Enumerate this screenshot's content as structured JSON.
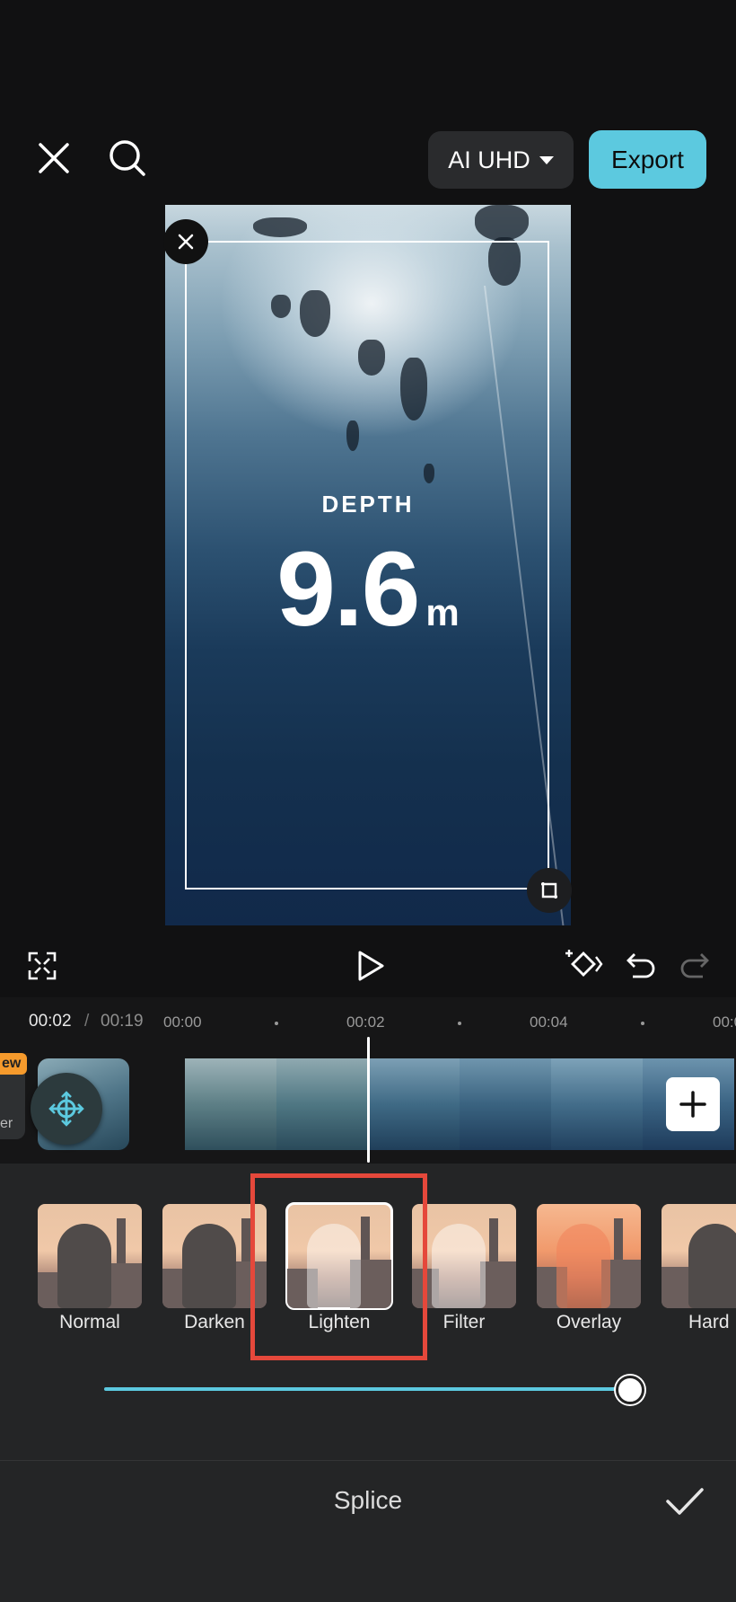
{
  "topbar": {
    "close_icon": "close-icon",
    "search_icon": "search-icon",
    "quality_label": "AI UHD",
    "export_label": "Export"
  },
  "preview": {
    "depth_label": "DEPTH",
    "depth_value": "9.6",
    "depth_unit": "m"
  },
  "playback": {
    "icons": [
      "fullscreen-icon",
      "play-icon",
      "keyframe-icon",
      "undo-icon",
      "redo-icon"
    ]
  },
  "timeline": {
    "current_time": "00:02",
    "separator": "/",
    "total_time": "00:19",
    "ticks": [
      "00:00",
      "00:02",
      "00:04",
      "00:0"
    ],
    "new_badge": "ew",
    "side_clip_label": "er",
    "cover_label": "er"
  },
  "blend": {
    "modes": [
      "Normal",
      "Darken",
      "Lighten",
      "Filter",
      "Overlay",
      "Hard"
    ],
    "selected": "Lighten",
    "opacity": 1.0
  },
  "bottom": {
    "title": "Splice"
  },
  "colors": {
    "accent": "#5cc9df",
    "annotation": "#e5483b",
    "background": "#111112",
    "panel": "#242526"
  }
}
